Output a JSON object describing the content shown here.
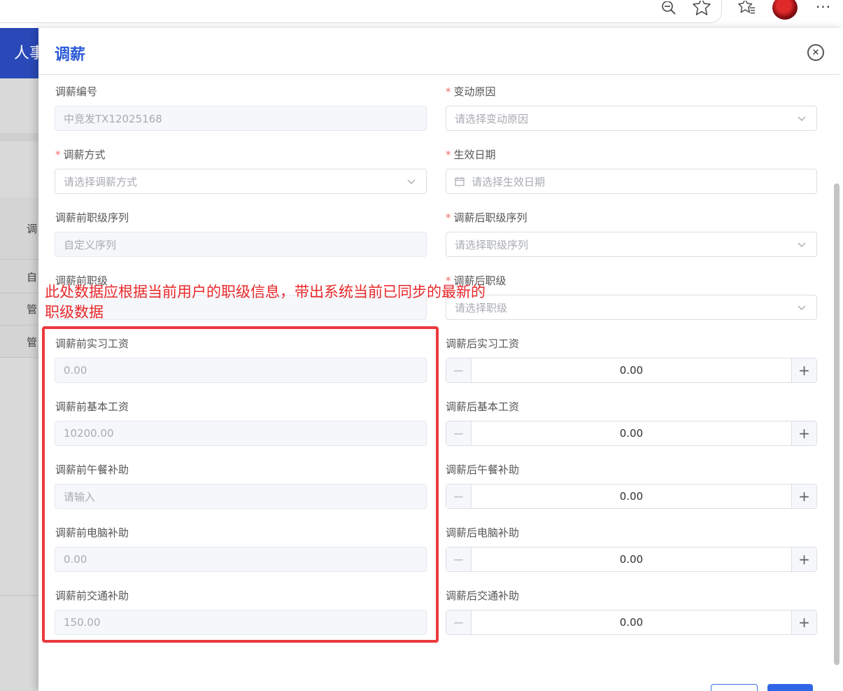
{
  "background_app": {
    "header_title": "人事",
    "table_header_cell": "调",
    "rows": [
      "自",
      "管",
      "管"
    ]
  },
  "drawer": {
    "title": "调薪"
  },
  "form": {
    "salary_no": {
      "label": "调薪编号",
      "value": "中竞发TX12025168"
    },
    "change_reason": {
      "label": "变动原因",
      "placeholder": "请选择变动原因"
    },
    "method": {
      "label": "调薪方式",
      "placeholder": "请选择调薪方式"
    },
    "effective_date": {
      "label": "生效日期",
      "placeholder": "请选择生效日期"
    },
    "before_sequence": {
      "label": "调薪前职级序列",
      "value": "自定义序列"
    },
    "after_sequence": {
      "label": "调薪后职级序列",
      "placeholder": "请选择职级序列"
    },
    "before_level": {
      "label": "调薪前职级"
    },
    "after_level": {
      "label": "调薪后职级",
      "placeholder": "请选择职级"
    },
    "before_intern": {
      "label": "调薪前实习工资",
      "value": "0.00"
    },
    "after_intern": {
      "label": "调薪后实习工资",
      "value": "0.00"
    },
    "before_base": {
      "label": "调薪前基本工资",
      "value": "10200.00"
    },
    "after_base": {
      "label": "调薪后基本工资",
      "value": "0.00"
    },
    "before_lunch": {
      "label": "调薪前午餐补助",
      "placeholder": "请输入"
    },
    "after_lunch": {
      "label": "调薪后午餐补助",
      "value": "0.00"
    },
    "before_computer": {
      "label": "调薪前电脑补助",
      "value": "0.00"
    },
    "after_computer": {
      "label": "调薪后电脑补助",
      "value": "0.00"
    },
    "before_traffic": {
      "label": "调薪前交通补助",
      "value": "150.00"
    },
    "after_traffic": {
      "label": "调薪后交通补助",
      "value": "0.00"
    }
  },
  "annotation": {
    "text": "此处数据应根据当前用户的职级信息，带出系统当前已同步的最新的职级数据"
  },
  "colors": {
    "primary": "#2d5bd7",
    "required": "#f56c6c",
    "annotation": "#e8282b"
  }
}
